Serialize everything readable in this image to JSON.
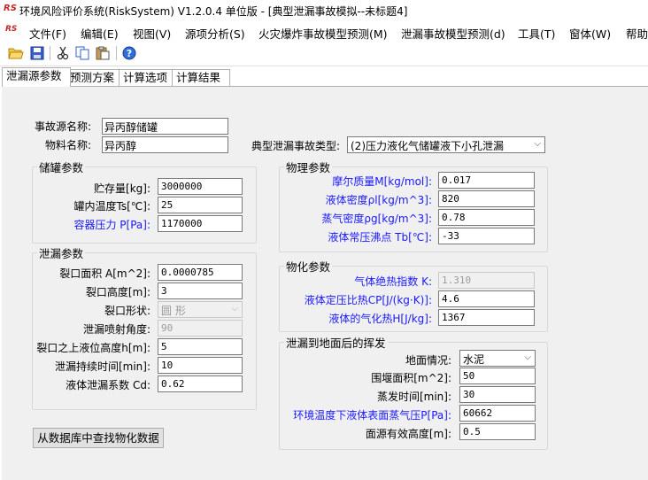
{
  "window": {
    "logo_text": "RS",
    "title": "环境风险评价系统(RiskSystem) V1.2.0.4 单位版 - [典型泄漏事故模拟--未标题4]"
  },
  "menu": {
    "logo_text": "RS",
    "items": [
      "文件(F)",
      "编辑(E)",
      "视图(V)",
      "源项分析(S)",
      "火灾爆炸事故模型预测(M)",
      "泄漏事故模型预测(d)",
      "工具(T)",
      "窗体(W)",
      "帮助"
    ]
  },
  "toolbar": {
    "icons": [
      "open-folder-icon",
      "save-icon",
      "cut-icon",
      "copy-icon",
      "paste-icon",
      "help-icon"
    ]
  },
  "tabs": [
    "泄漏源参数",
    "预测方案",
    "计算选项",
    "计算结果"
  ],
  "source": {
    "name_label": "事故源名称:",
    "name_value": "异丙醇储罐",
    "material_label": "物料名称:",
    "material_value": "异丙醇",
    "type_label": "典型泄漏事故类型:",
    "type_value": "(2)压力液化气储罐液下小孔泄漏"
  },
  "tank": {
    "title": "储罐参数",
    "storage_label": "贮存量[kg]:",
    "storage_value": "3000000",
    "temp_label": "罐内温度Ts[℃]:",
    "temp_value": "25",
    "pressure_label": "容器压力 P[Pa]:",
    "pressure_value": "1170000"
  },
  "physical": {
    "title": "物理参数",
    "molar_label": "摩尔质量M[kg/mol]:",
    "molar_value": "0.017",
    "liquid_density_label": "液体密度ρl[kg/m^3]:",
    "liquid_density_value": "820",
    "vapor_density_label": "蒸气密度ρg[kg/m^3]:",
    "vapor_density_value": "0.78",
    "boiling_label": "液体常压沸点 Tb[℃]:",
    "boiling_value": "-33"
  },
  "leak": {
    "title": "泄漏参数",
    "area_label": "裂口面积 A[m^2]:",
    "area_value": "0.0000785",
    "height_label": "裂口高度[m]:",
    "height_value": "3",
    "shape_label": "裂口形状:",
    "shape_value": "圆  形",
    "angle_label": "泄漏喷射角度:",
    "angle_value": "90",
    "liquid_height_label": "裂口之上液位高度h[m]:",
    "liquid_height_value": "5",
    "duration_label": "泄漏持续时间[min]:",
    "duration_value": "10",
    "coef_label": "液体泄漏系数  Cd:",
    "coef_value": "0.62"
  },
  "physchem": {
    "title": "物化参数",
    "adiabatic_label": "气体绝热指数  K:",
    "adiabatic_value": "1.310",
    "cp_label": "液体定压比热CP[J/(kg·K)]:",
    "cp_value": "4.6",
    "vapor_heat_label": "液体的气化热H[J/kg]:",
    "vapor_heat_value": "1367"
  },
  "evaporation": {
    "title": "泄漏到地面后的挥发",
    "ground_label": "地面情况:",
    "ground_value": "水泥",
    "dike_label": "围堰面积[m^2]:",
    "dike_value": "50",
    "evap_time_label": "蒸发时间[min]:",
    "evap_time_value": "30",
    "vapor_pressure_label": "环境温度下液体表面蒸气压P[Pa]:",
    "vapor_pressure_value": "60662",
    "area_height_label": "面源有效高度[m]:",
    "area_height_value": "0.5"
  },
  "buttons": {
    "lookup": "从数据库中查找物化数据"
  },
  "colors": {
    "highlight_label": "#1a1aff",
    "panel_bg": "#f0f0f0"
  }
}
